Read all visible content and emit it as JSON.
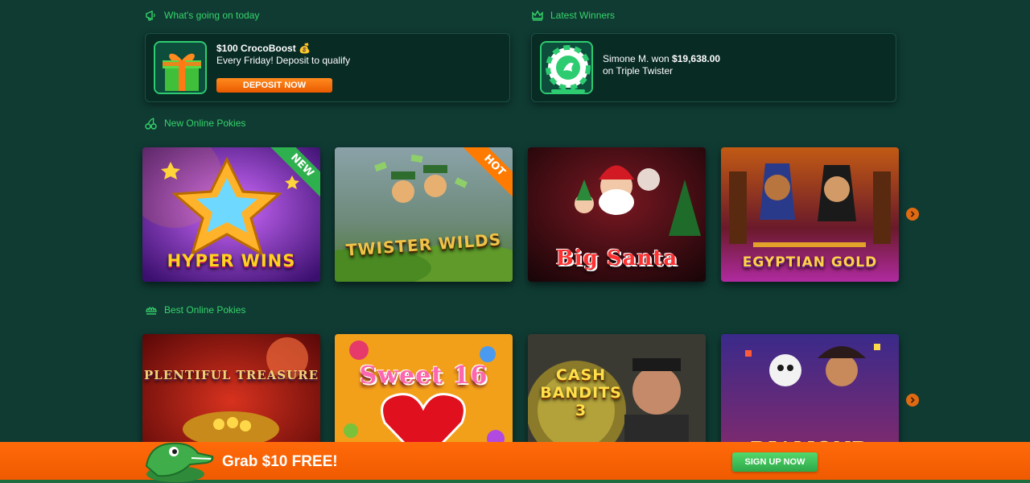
{
  "sections": {
    "today": "What's going on today",
    "winners": "Latest Winners",
    "new_pokies": "New Online Pokies",
    "best_pokies": "Best Online Pokies"
  },
  "promo": {
    "title": "$100 CrocoBoost 💰",
    "subtitle": "Every Friday! Deposit to qualify",
    "button": "DEPOSIT NOW",
    "icon": "gift-icon"
  },
  "winner": {
    "name_text": "Simone M. won ",
    "amount": "$19,638.00",
    "game": "on Triple Twister",
    "icon": "casino-chip-icon"
  },
  "new_games": [
    {
      "title": "HYPER WINS",
      "badge": "NEW"
    },
    {
      "title": "TWISTER WILDS",
      "badge": "HOT"
    },
    {
      "title": "Big Santa",
      "badge": ""
    },
    {
      "title": "EGYPTIAN GOLD",
      "badge": ""
    }
  ],
  "best_games": [
    {
      "title": "PLENTIFUL TREASURE"
    },
    {
      "title": "Sweet 16"
    },
    {
      "title": "CASH BANDITS 3"
    },
    {
      "title": "DIAMOND"
    }
  ],
  "bottom_bar": {
    "text": "Grab $10 FREE!",
    "button": "SIGN UP NOW"
  },
  "colors": {
    "background": "#0f3b33",
    "accent_green": "#36d46a",
    "accent_orange": "#ff6a0a"
  }
}
